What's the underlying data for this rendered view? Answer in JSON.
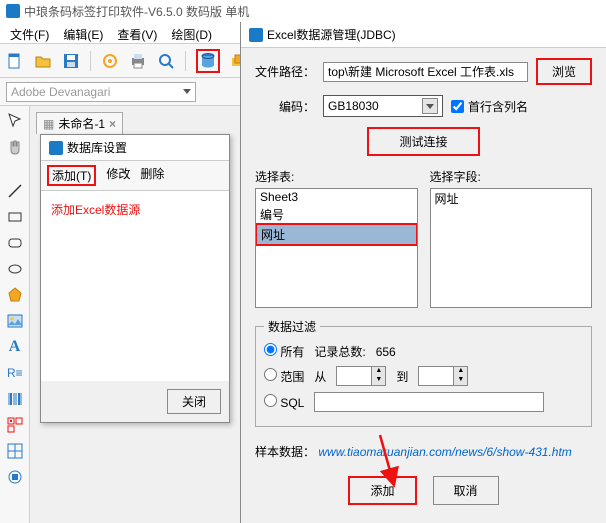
{
  "app": {
    "title": "中琅条码标签打印软件-V6.5.0 数码版 单机"
  },
  "menu": {
    "file": "文件(F)",
    "edit": "编辑(E)",
    "view": "查看(V)",
    "draw": "绘图(D)"
  },
  "font": {
    "name": "Adobe Devanagari"
  },
  "doc": {
    "tab": "未命名-1",
    "icon": "⬚"
  },
  "dbset": {
    "title": "数据库设置",
    "add": "添加(T)",
    "modify": "修改",
    "delete": "删除",
    "note": "添加Excel数据源",
    "close": "关闭"
  },
  "jdbc": {
    "title": "Excel数据源管理(JDBC)",
    "path_lbl": "文件路径：",
    "path_val": "top\\新建 Microsoft Excel 工作表.xls",
    "browse": "浏览",
    "enc_lbl": "编码：",
    "enc_val": "GB18030",
    "firstrow": "首行含列名",
    "test": "测试连接",
    "seltable": "选择表:",
    "selfield": "选择字段:",
    "tables": [
      "Sheet3",
      "编号",
      "网址"
    ],
    "fields": [
      "网址"
    ],
    "filter": "数据过滤",
    "all": "所有",
    "count_lbl": "记录总数:",
    "count_val": "656",
    "range": "范围",
    "from": "从",
    "to": "到",
    "sql": "SQL",
    "sample_lbl": "样本数据：",
    "sample_url": "www.tiaomaruanjian.com/news/6/show-431.htm",
    "ok": "添加",
    "cancel": "取消"
  }
}
